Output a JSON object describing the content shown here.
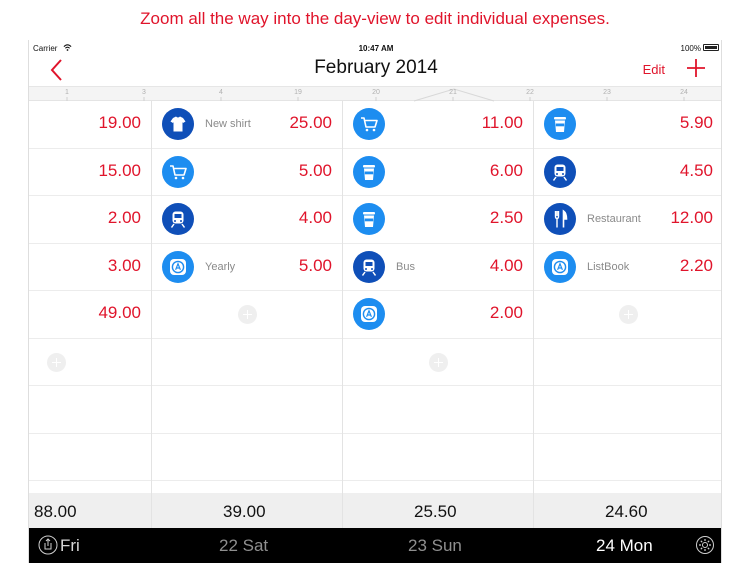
{
  "caption": "Zoom all the way into the day-view to edit individual expenses.",
  "status_bar": {
    "carrier": "Carrier",
    "time": "10:47 AM",
    "battery": "100%"
  },
  "nav": {
    "title": "February 2014",
    "edit_label": "Edit"
  },
  "ruler_ticks": [
    "1",
    "3",
    "4",
    "19",
    "20",
    "21",
    "22",
    "23",
    "24"
  ],
  "columns": [
    {
      "day": "Fri",
      "total": "88.00",
      "expenses": [
        {
          "amount": "19.00"
        },
        {
          "amount": "15.00"
        },
        {
          "amount": "2.00"
        },
        {
          "amount": "3.00"
        },
        {
          "amount": "49.00"
        }
      ]
    },
    {
      "day": "22 Sat",
      "total": "39.00",
      "expenses": [
        {
          "icon": "shirt-icon",
          "note": "New shirt",
          "amount": "25.00"
        },
        {
          "icon": "cart-icon",
          "amount": "5.00"
        },
        {
          "icon": "train-icon",
          "amount": "4.00"
        },
        {
          "icon": "app-store-icon",
          "note": "Yearly",
          "amount": "5.00"
        }
      ]
    },
    {
      "day": "23 Sun",
      "total": "25.50",
      "expenses": [
        {
          "icon": "cart-icon",
          "amount": "11.00"
        },
        {
          "icon": "coffee-cup-icon",
          "amount": "6.00"
        },
        {
          "icon": "coffee-cup-icon",
          "amount": "2.50"
        },
        {
          "icon": "train-icon",
          "note": "Bus",
          "amount": "4.00"
        },
        {
          "icon": "app-store-icon",
          "amount": "2.00"
        }
      ]
    },
    {
      "day": "24 Mon",
      "total": "24.60",
      "expenses": [
        {
          "icon": "coffee-cup-icon",
          "amount": "5.90"
        },
        {
          "icon": "train-icon",
          "amount": "4.50"
        },
        {
          "icon": "fork-knife-icon",
          "note": "Restaurant",
          "amount": "12.00"
        },
        {
          "icon": "app-store-icon",
          "note": "ListBook",
          "amount": "2.20"
        }
      ]
    }
  ],
  "colors": {
    "accent_red": "#e0142b",
    "icon_light_blue": "#1d8df0",
    "icon_dark_blue": "#0f4fb8"
  }
}
